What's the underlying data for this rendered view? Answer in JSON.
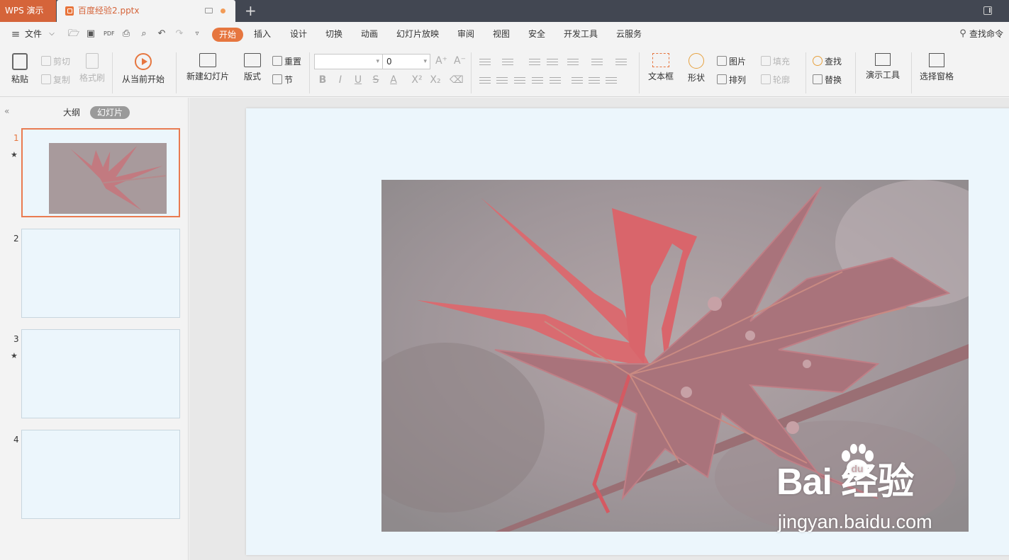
{
  "titlebar": {
    "app_name": "WPS 演示",
    "document_name": "百度经验2.pptx",
    "new_tab_symbol": "+"
  },
  "menubar": {
    "file_label": "文件",
    "tabs": [
      "开始",
      "插入",
      "设计",
      "切换",
      "动画",
      "幻灯片放映",
      "审阅",
      "视图",
      "安全",
      "开发工具",
      "云服务"
    ],
    "active_tab": "开始",
    "search_command_label": "查找命令"
  },
  "ribbon": {
    "paste": "粘贴",
    "cut": "剪切",
    "copy": "复制",
    "format_painter": "格式刷",
    "start_from_current": "从当前开始",
    "new_slide": "新建幻灯片",
    "layout": "版式",
    "reset": "重置",
    "section": "节",
    "font_name": "",
    "font_size": "0",
    "text_box": "文本框",
    "shape": "形状",
    "picture": "图片",
    "arrange": "排列",
    "fill": "填充",
    "outline": "轮廓",
    "find": "查找",
    "replace": "替换",
    "presentation_tools": "演示工具",
    "selection_pane": "选择窗格"
  },
  "left_panel": {
    "tab_outline": "大纲",
    "tab_slides": "幻灯片",
    "active_tab": "幻灯片",
    "thumbnails": [
      {
        "number": "1",
        "has_star": true,
        "selected": true
      },
      {
        "number": "2",
        "has_star": false,
        "selected": false
      },
      {
        "number": "3",
        "has_star": true,
        "selected": false
      },
      {
        "number": "4",
        "has_star": false,
        "selected": false
      }
    ]
  },
  "slide": {
    "image_description_icon": "red-maple-leaf-photo",
    "watermark_brand": "Bai  经验",
    "watermark_url": "jingyan.baidu.com"
  },
  "colors": {
    "titlebar_bg": "#424752",
    "accent": "#e6763f",
    "slide_bg": "#ecf6fc",
    "thumb_selected_border": "#e97b51"
  }
}
